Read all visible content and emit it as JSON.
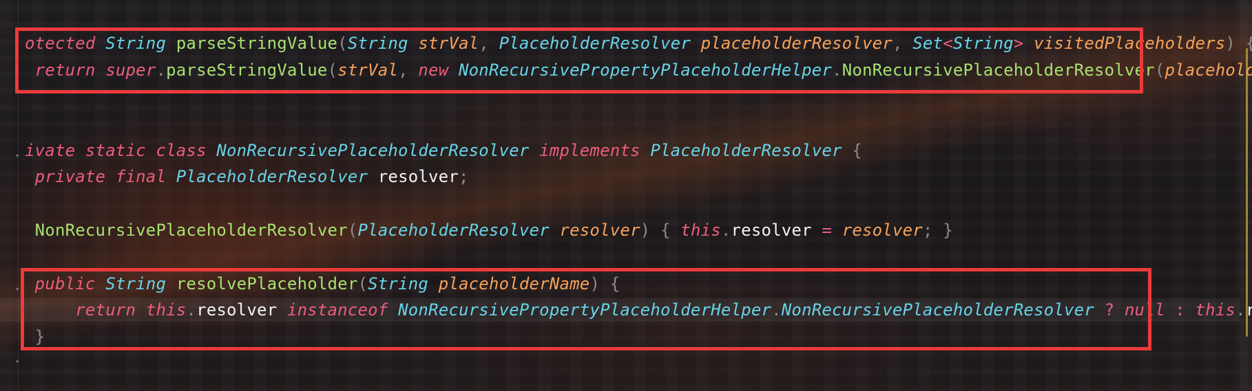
{
  "editor": {
    "accent_colors": {
      "keyword": "#ec5d7d",
      "type": "#66d4e8",
      "method": "#a8e070",
      "param": "#f7a25a",
      "plain": "#f2f2f2",
      "punct": "#8c8c8c",
      "highlight_box": "#ec3b3b"
    },
    "lines": [
      [
        {
          "t": "otected",
          "k": "kw"
        },
        {
          "t": " ",
          "k": "pl"
        },
        {
          "t": "String",
          "k": "ty"
        },
        {
          "t": " ",
          "k": "pl"
        },
        {
          "t": "parseStringValue",
          "k": "fn"
        },
        {
          "t": "(",
          "k": "pu"
        },
        {
          "t": "String",
          "k": "ty"
        },
        {
          "t": " ",
          "k": "pl"
        },
        {
          "t": "strVal",
          "k": "par"
        },
        {
          "t": ", ",
          "k": "pu"
        },
        {
          "t": "PlaceholderResolver",
          "k": "ty"
        },
        {
          "t": " ",
          "k": "pl"
        },
        {
          "t": "placeholderResolver",
          "k": "par"
        },
        {
          "t": ", ",
          "k": "pu"
        },
        {
          "t": "Set",
          "k": "ty"
        },
        {
          "t": "<",
          "k": "op"
        },
        {
          "t": "String",
          "k": "ty"
        },
        {
          "t": ">",
          "k": "op"
        },
        {
          "t": " ",
          "k": "pl"
        },
        {
          "t": "visitedPlaceholders",
          "k": "par"
        },
        {
          "t": ") {",
          "k": "pu"
        }
      ],
      [
        {
          "t": " ",
          "k": "pl"
        },
        {
          "t": "return",
          "k": "kw"
        },
        {
          "t": " ",
          "k": "pl"
        },
        {
          "t": "super",
          "k": "kw"
        },
        {
          "t": ".",
          "k": "pu"
        },
        {
          "t": "parseStringValue",
          "k": "fn"
        },
        {
          "t": "(",
          "k": "pu"
        },
        {
          "t": "strVal",
          "k": "par"
        },
        {
          "t": ", ",
          "k": "pu"
        },
        {
          "t": "new",
          "k": "kw"
        },
        {
          "t": " ",
          "k": "pl"
        },
        {
          "t": "NonRecursivePropertyPlaceholderHelper",
          "k": "ty"
        },
        {
          "t": ".",
          "k": "pu"
        },
        {
          "t": "NonRecursivePlaceholderResolver",
          "k": "fn"
        },
        {
          "t": "(",
          "k": "pu"
        },
        {
          "t": "placeholderRes",
          "k": "par"
        }
      ],
      [],
      [
        {
          "t": "ivate",
          "k": "kw"
        },
        {
          "t": " ",
          "k": "pl"
        },
        {
          "t": "static",
          "k": "kw"
        },
        {
          "t": " ",
          "k": "pl"
        },
        {
          "t": "class",
          "k": "kw"
        },
        {
          "t": " ",
          "k": "pl"
        },
        {
          "t": "NonRecursivePlaceholderResolver",
          "k": "ty"
        },
        {
          "t": " ",
          "k": "pl"
        },
        {
          "t": "implements",
          "k": "kw"
        },
        {
          "t": " ",
          "k": "pl"
        },
        {
          "t": "PlaceholderResolver",
          "k": "ty"
        },
        {
          "t": " {",
          "k": "pu"
        }
      ],
      [
        {
          "t": " ",
          "k": "pl"
        },
        {
          "t": "private",
          "k": "kw"
        },
        {
          "t": " ",
          "k": "pl"
        },
        {
          "t": "final",
          "k": "kw"
        },
        {
          "t": " ",
          "k": "pl"
        },
        {
          "t": "PlaceholderResolver",
          "k": "ty"
        },
        {
          "t": " ",
          "k": "pl"
        },
        {
          "t": "resolver",
          "k": "pl"
        },
        {
          "t": ";",
          "k": "pu"
        }
      ],
      [],
      [
        {
          "t": " ",
          "k": "pl"
        },
        {
          "t": "NonRecursivePlaceholderResolver",
          "k": "fn"
        },
        {
          "t": "(",
          "k": "pu"
        },
        {
          "t": "PlaceholderResolver",
          "k": "ty"
        },
        {
          "t": " ",
          "k": "pl"
        },
        {
          "t": "resolver",
          "k": "par"
        },
        {
          "t": ") { ",
          "k": "pu"
        },
        {
          "t": "this",
          "k": "kw"
        },
        {
          "t": ".",
          "k": "pu"
        },
        {
          "t": "resolver",
          "k": "pl"
        },
        {
          "t": " ",
          "k": "pl"
        },
        {
          "t": "=",
          "k": "op"
        },
        {
          "t": " ",
          "k": "pl"
        },
        {
          "t": "resolver",
          "k": "par"
        },
        {
          "t": "; }",
          "k": "pu"
        }
      ],
      [],
      [
        {
          "t": " ",
          "k": "pl"
        },
        {
          "t": "public",
          "k": "kw"
        },
        {
          "t": " ",
          "k": "pl"
        },
        {
          "t": "String",
          "k": "ty"
        },
        {
          "t": " ",
          "k": "pl"
        },
        {
          "t": "resolvePlaceholder",
          "k": "fn"
        },
        {
          "t": "(",
          "k": "pu"
        },
        {
          "t": "String",
          "k": "ty"
        },
        {
          "t": " ",
          "k": "pl"
        },
        {
          "t": "placeholderName",
          "k": "par"
        },
        {
          "t": ") {",
          "k": "pu"
        }
      ],
      [
        {
          "t": "     ",
          "k": "pl"
        },
        {
          "t": "return",
          "k": "kw"
        },
        {
          "t": " ",
          "k": "pl"
        },
        {
          "t": "this",
          "k": "kw"
        },
        {
          "t": ".",
          "k": "pu"
        },
        {
          "t": "resolver",
          "k": "pl"
        },
        {
          "t": " ",
          "k": "pl"
        },
        {
          "t": "instanceof",
          "k": "kw"
        },
        {
          "t": " ",
          "k": "pl"
        },
        {
          "t": "NonRecursivePropertyPlaceholderHelper",
          "k": "ty"
        },
        {
          "t": ".",
          "k": "pu"
        },
        {
          "t": "NonRecursivePlaceholderResolver",
          "k": "ty"
        },
        {
          "t": " ",
          "k": "pl"
        },
        {
          "t": "?",
          "k": "op"
        },
        {
          "t": " ",
          "k": "pl"
        },
        {
          "t": "null",
          "k": "kw"
        },
        {
          "t": " ",
          "k": "pl"
        },
        {
          "t": ":",
          "k": "op"
        },
        {
          "t": " ",
          "k": "pl"
        },
        {
          "t": "this",
          "k": "kw"
        },
        {
          "t": ".",
          "k": "pu"
        },
        {
          "t": "resolv",
          "k": "pl"
        }
      ],
      [
        {
          "t": " }",
          "k": "pu"
        }
      ]
    ]
  }
}
